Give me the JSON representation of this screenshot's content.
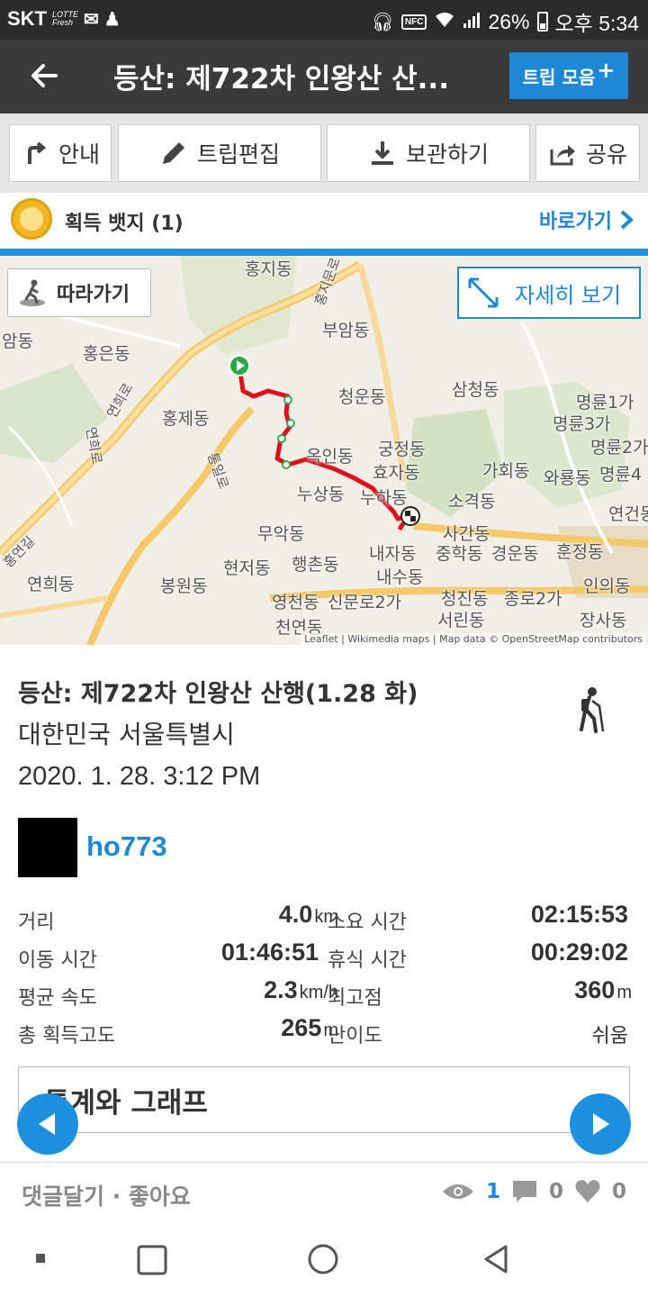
{
  "status_bar": {
    "carrier": "SKT",
    "lotte_text": "LOTTE Fresh",
    "battery": "26%",
    "time": "오후 5:34",
    "nfc_label": "NFC"
  },
  "app_bar": {
    "title": "등산: 제722차 인왕산 산...",
    "trip_collection_label": "트립 모음",
    "trip_collection_plus": "+"
  },
  "toolbar": {
    "guide_label": "안내",
    "edit_label": "트립편집",
    "save_label": "보관하기",
    "share_label": "공유"
  },
  "badge": {
    "label": "획득 뱃지 (1)",
    "goto_label": "바로가기"
  },
  "map": {
    "follow_label": "따라가기",
    "detail_label": "자세히 보기",
    "attribution": "Leaflet | Wikimedia maps | Map data © OpenStreetMap contributors",
    "place_labels": {
      "hongji": "홍지동",
      "buam": "부암동",
      "am": "암동",
      "hongeun": "홍은동",
      "samcheong": "삼청동",
      "myeongnyun1": "명륜1가",
      "myeongnyun3": "명륜3가",
      "myeongnyun2": "명륜2가",
      "myeongnyun4": "명륜4",
      "cheongun": "청운동",
      "hongje": "홍제동",
      "gungjeong": "궁정동",
      "okin": "옥인동",
      "hyoja": "효자동",
      "gahoe": "가회동",
      "waryong": "와룡동",
      "nusang": "누상동",
      "nuha": "누하동",
      "sogyeok": "소격동",
      "yeongeon": "연건동",
      "muak": "무악동",
      "sagan": "사간동",
      "naeja": "내자동",
      "junghak": "중학동",
      "gyeongun": "경운동",
      "hunjeong": "훈정동",
      "hyeonjeo": "현저동",
      "haengchon": "행촌동",
      "naesu": "내수동",
      "yeonhui": "연희동",
      "bongwon": "봉원동",
      "inui": "인의동",
      "yeongcheon": "영천동",
      "sinmunno2": "신문로2가",
      "cheongjin": "청진동",
      "jongno2": "종로2가",
      "seorin": "서린동",
      "jangsa": "장사동",
      "cheonyeon": "천연동",
      "yeonhui_ro": "연희로",
      "hongyeon_gil": "홍연길",
      "yeonhui_ro2": "연희로",
      "tongil_ro": "통일로",
      "hongji_munro": "홍지문로"
    }
  },
  "trip": {
    "title": "등산: 제722차 인왕산 산행(1.28 화)",
    "location": "대한민국 서울특별시",
    "datetime": "2020. 1. 28. 3:12 PM",
    "activity_icon": "hiking-icon",
    "user": "ho773"
  },
  "stats": {
    "distance_label": "거리",
    "distance_value": "4.0",
    "distance_unit": "km",
    "duration_label": "소요 시간",
    "duration_value": "02:15:53",
    "moving_label": "이동 시간",
    "moving_value": "01:46:51",
    "rest_label": "휴식 시간",
    "rest_value": "00:29:02",
    "avg_speed_label": "평균 속도",
    "avg_speed_value": "2.3",
    "avg_speed_unit": "km/h",
    "max_alt_label": "최고점",
    "max_alt_value": "360",
    "max_alt_unit": "m",
    "gain_label": "총 획득고도",
    "gain_value": "265",
    "gain_unit": "m",
    "difficulty_label": "난이도",
    "difficulty_value": "쉬움"
  },
  "graph": {
    "title": "통계와 그래프"
  },
  "footer": {
    "comment_like": "댓글달기 · 좋아요",
    "views": "1",
    "comments": "0",
    "likes": "0"
  },
  "colors": {
    "accent": "#1e88d6",
    "route": "#e0101a",
    "appbar": "#3a3a3a"
  }
}
